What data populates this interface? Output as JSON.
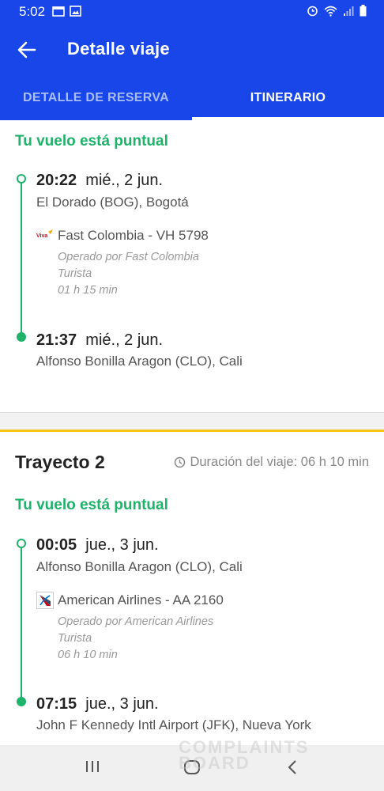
{
  "status": {
    "time": "5:02"
  },
  "appbar": {
    "title": "Detalle viaje"
  },
  "tabs": [
    {
      "label": "DETALLE DE RESERVA"
    },
    {
      "label": "ITINERARIO"
    }
  ],
  "segment1": {
    "status": "Tu vuelo está puntual",
    "departure": {
      "time": "20:22",
      "date": "mié., 2 jun.",
      "place": "El Dorado (BOG), Bogotá"
    },
    "flight": {
      "airline": "Fast Colombia - VH 5798",
      "operated": "Operado por Fast Colombia",
      "cabin": "Turista",
      "duration": "01 h 15 min"
    },
    "arrival": {
      "time": "21:37",
      "date": "mié., 2 jun.",
      "place": "Alfonso Bonilla Aragon (CLO), Cali"
    }
  },
  "segment2": {
    "title": "Trayecto 2",
    "trip_duration": "Duración del viaje: 06 h 10 min",
    "status": "Tu vuelo está puntual",
    "departure": {
      "time": "00:05",
      "date": "jue., 3 jun.",
      "place": "Alfonso Bonilla Aragon (CLO), Cali"
    },
    "flight": {
      "airline": "American Airlines - AA 2160",
      "operated": "Operado por American Airlines",
      "cabin": "Turista",
      "duration": "06 h 10 min"
    },
    "arrival": {
      "time": "07:15",
      "date": "jue., 3 jun.",
      "place": "John F Kennedy Intl Airport (JFK), Nueva York"
    }
  },
  "watermark": {
    "line1": "COMPLAINTS",
    "line2": "BOARD"
  },
  "colors": {
    "primary": "#1946e8",
    "green": "#1db36a",
    "yellow": "#f5c518"
  }
}
